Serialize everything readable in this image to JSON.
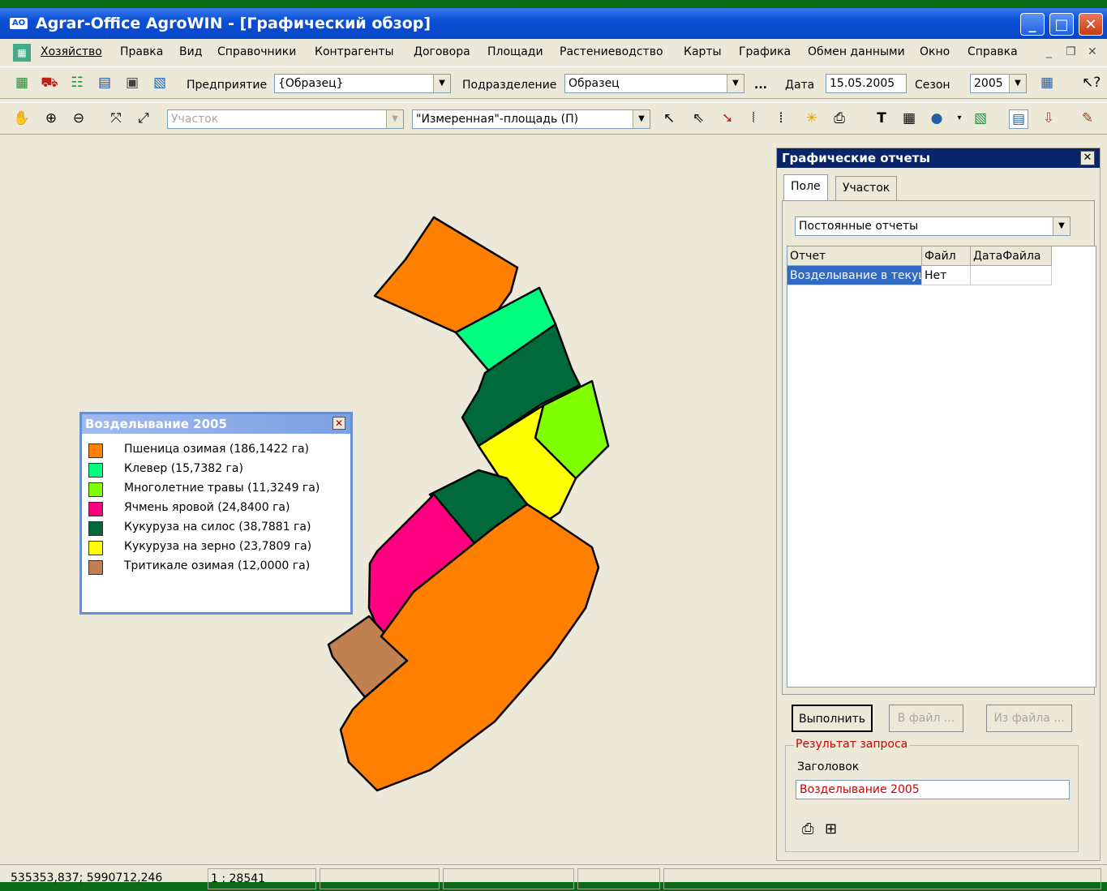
{
  "window": {
    "app_icon": "AO",
    "title": "Agrar-Office AgroWIN  - [Графический обзор]"
  },
  "menu": [
    "Хозяйство",
    "Правка",
    "Вид",
    "Справочники",
    "Контрагенты",
    "Договора",
    "Площади",
    "Растениеводство",
    "Карты",
    "Графика",
    "Обмен данными",
    "Окно",
    "Справка"
  ],
  "toolbar1": {
    "enterprise_label": "Предприятие",
    "enterprise_value": "{Образец}",
    "division_label": "Подразделение",
    "division_value": "Образец",
    "ellipsis": "...",
    "date_label": "Дата",
    "date_value": "15.05.2005",
    "season_label": "Сезон",
    "season_value": "2005"
  },
  "toolbar2": {
    "plot_placeholder": "Участок",
    "area_value": "\"Измеренная\"-площадь (П)",
    "text_tool": "T"
  },
  "legend": {
    "title": "Возделывание 2005",
    "items": [
      {
        "label": "Пшеница озимая (186,1422 га)",
        "color": "#ff8000"
      },
      {
        "label": "Клевер (15,7382 га)",
        "color": "#00ff80"
      },
      {
        "label": "Многолетние травы (11,3249 га)",
        "color": "#80ff00"
      },
      {
        "label": "Ячмень яровой (24,8400 га)",
        "color": "#ff0080"
      },
      {
        "label": "Кукуруза на силос (38,7881 га)",
        "color": "#006a3c"
      },
      {
        "label": "Кукуруза на зерно (23,7809 га)",
        "color": "#ffff00"
      },
      {
        "label": "Тритикале озимая (12,0000 га)",
        "color": "#c08050"
      }
    ]
  },
  "panel": {
    "title": "Графические отчеты",
    "tabs": [
      "Поле",
      "Участок"
    ],
    "report_type": "Постоянные отчеты",
    "columns": [
      "Отчет",
      "Файл",
      "ДатаФайла"
    ],
    "rows": [
      {
        "report": "Возделывание в текущем",
        "file": "Нет",
        "date": ""
      }
    ],
    "execute": "Выполнить",
    "to_file": "В файл ...",
    "from_file": "Из файла ...",
    "result_group": "Результат запроса",
    "header_label": "Заголовок",
    "header_value": "Возделывание 2005"
  },
  "status": {
    "coords": "535353,837; 5990712,246",
    "scale": "1 : 28541"
  },
  "colors": {
    "title_bar": "#0a4fd6",
    "desktop": "#0b6a16",
    "selection": "#316ac5",
    "result_text": "#d00000"
  }
}
